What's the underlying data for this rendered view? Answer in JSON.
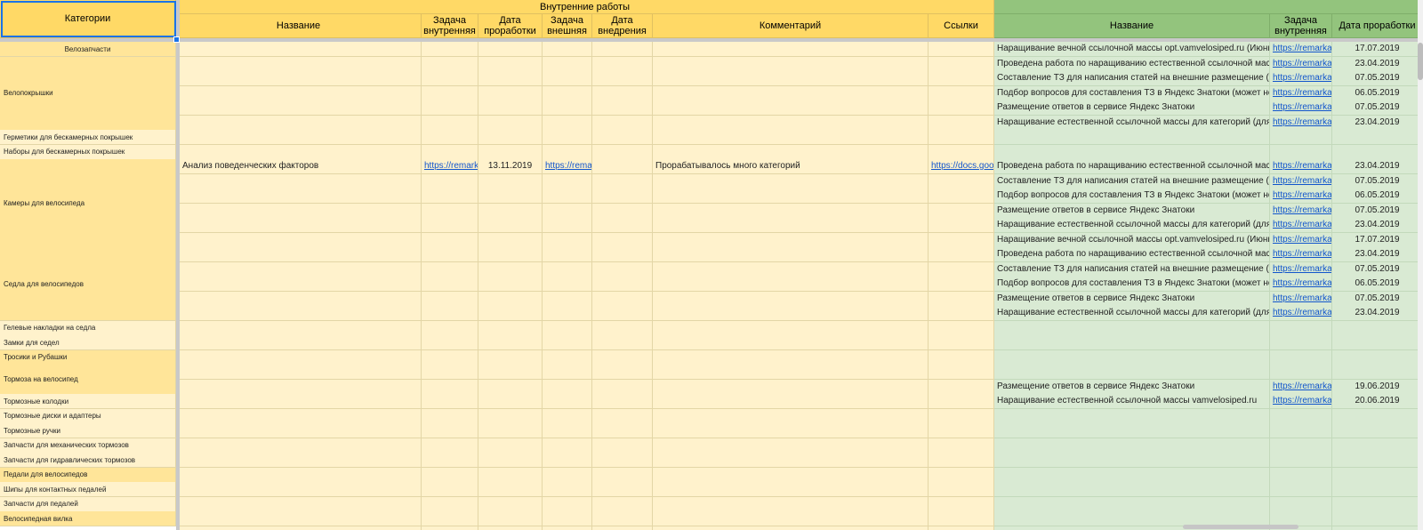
{
  "header": {
    "categories": "Категории",
    "group_internal": "Внутренние работы",
    "internal_cols": [
      "Название",
      "Задача внутренняя",
      "Дата проработки",
      "Задача внешняя",
      "Дата внедрения",
      "Комментарий",
      "Ссылки"
    ],
    "external_cols": [
      "Название",
      "Задача внутренняя",
      "Дата проработки"
    ]
  },
  "categories": [
    {
      "label": "Велозапчасти",
      "rows": 1,
      "style": "dark",
      "center": true
    },
    {
      "label": "Велопокрышки",
      "rows": 5,
      "style": "dark"
    },
    {
      "label": "Герметики для бескамерных покрышек",
      "rows": 1,
      "style": "light"
    },
    {
      "label": "Наборы для бескамерных покрышек",
      "rows": 1,
      "style": "light"
    },
    {
      "label": "Камеры для велосипеда",
      "rows": 6,
      "style": "dark"
    },
    {
      "label": "Седла для велосипедов",
      "rows": 5,
      "style": "dark"
    },
    {
      "label": "Гелевые накладки на седла",
      "rows": 1,
      "style": "light"
    },
    {
      "label": "Замки для седел",
      "rows": 1,
      "style": "light"
    },
    {
      "label": "Тросики и Рубашки",
      "rows": 1,
      "style": "dark"
    },
    {
      "label": "Тормоза на велосипед",
      "rows": 2,
      "style": "dark"
    },
    {
      "label": "Тормозные колодки",
      "rows": 1,
      "style": "light"
    },
    {
      "label": "Тормозные диски и адаптеры",
      "rows": 1,
      "style": "light"
    },
    {
      "label": "Тормозные ручки",
      "rows": 1,
      "style": "light"
    },
    {
      "label": "Запчасти для механических тормозов",
      "rows": 1,
      "style": "light"
    },
    {
      "label": "Запчасти для гидравлических тормозов",
      "rows": 1,
      "style": "light"
    },
    {
      "label": "Педали для велосипедов",
      "rows": 1,
      "style": "dark"
    },
    {
      "label": "Шипы для контактных педалей",
      "rows": 1,
      "style": "light"
    },
    {
      "label": "Запчасти для педалей",
      "rows": 1,
      "style": "light"
    },
    {
      "label": "Велосипедная вилка",
      "rows": 1,
      "style": "dark"
    }
  ],
  "internal_rows": {
    "8": [
      "Анализ поведенческих факторов",
      "https://remark",
      "13.11.2019",
      "https://rema",
      "",
      "Прорабатывалось много категорий",
      "https://docs.goo"
    ]
  },
  "external_rows": {
    "0": [
      "Наращивание вечной ссылочной массы opt.vamvelosiped.ru (Июнь",
      "https://remarka",
      "17.07.2019"
    ],
    "1": [
      "Проведена работа по наращиванию естественной ссылочной масс",
      "https://remarka",
      "23.04.2019"
    ],
    "2": [
      "Составление ТЗ для написания статей на внешние размещение (",
      "https://remarka",
      "07.05.2019"
    ],
    "3": [
      "Подбор вопросов для составления ТЗ в Яндекс Знатоки (может не",
      "https://remarka",
      "06.05.2019"
    ],
    "4": [
      "Размещение ответов в сервисе Яндекс Знатоки",
      "https://remarka",
      "07.05.2019"
    ],
    "5": [
      "Наращивание естественной ссылочной массы для категорий (для",
      "https://remarka",
      "23.04.2019"
    ],
    "8": [
      "Проведена работа по наращиванию естественной ссылочной масс",
      "https://remarka",
      "23.04.2019"
    ],
    "9": [
      "Составление ТЗ для написания статей на внешние размещение (",
      "https://remarka",
      "07.05.2019"
    ],
    "10": [
      "Подбор вопросов для составления ТЗ в Яндекс Знатоки (может не",
      "https://remarka",
      "06.05.2019"
    ],
    "11": [
      "Размещение ответов в сервисе Яндекс Знатоки",
      "https://remarka",
      "07.05.2019"
    ],
    "12": [
      "Наращивание естественной ссылочной массы для категорий (для",
      "https://remarka",
      "23.04.2019"
    ],
    "13": [
      "Наращивание вечной ссылочной массы opt.vamvelosiped.ru (Июнь",
      "https://remarka",
      "17.07.2019"
    ],
    "14": [
      "Проведена работа по наращиванию естественной ссылочной масс",
      "https://remarka",
      "23.04.2019"
    ],
    "15": [
      "Составление ТЗ для написания статей на внешние размещение (",
      "https://remarka",
      "07.05.2019"
    ],
    "16": [
      "Подбор вопросов для составления ТЗ в Яндекс Знатоки (может не",
      "https://remarka",
      "06.05.2019"
    ],
    "17": [
      "Размещение ответов в сервисе Яндекс Знатоки",
      "https://remarka",
      "07.05.2019"
    ],
    "18": [
      "Наращивание естественной ссылочной массы для категорий (для",
      "https://remarka",
      "23.04.2019"
    ],
    "23": [
      "Размещение ответов в сервисе Яндекс Знатоки",
      "https://remarka",
      "19.06.2019"
    ],
    "24": [
      "Наращивание естественной ссылочной массы vamvelosiped.ru",
      "https://remarka",
      "20.06.2019"
    ]
  },
  "colors": {
    "header_yellow": "#ffd966",
    "header_green": "#93c47d",
    "cell_yellow": "#fff2cc",
    "category_dark": "#ffe599",
    "cell_green": "#d9ead3",
    "link": "#1155cc",
    "selection": "#1a73e8"
  }
}
